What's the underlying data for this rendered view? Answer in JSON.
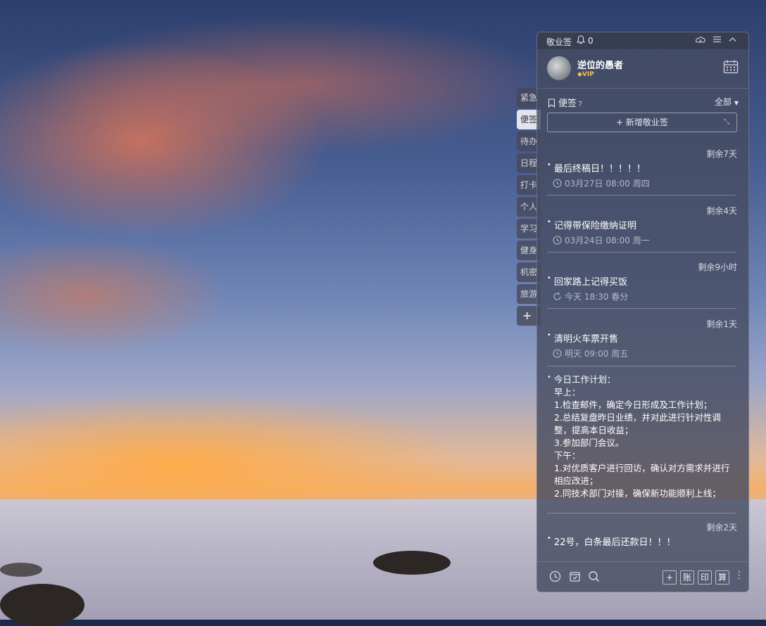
{
  "app": {
    "title": "敬业签",
    "notification_count": "0"
  },
  "profile": {
    "name": "逆位的愚者",
    "badge": "VIP"
  },
  "side_tabs": [
    "紧急",
    "便签",
    "待办",
    "日程",
    "打卡",
    "个人",
    "学习",
    "健身",
    "机密",
    "旅游"
  ],
  "side_add": "+",
  "section": {
    "title": "便签",
    "count": "7",
    "filter": "全部",
    "new_button": "+ 新增敬业签"
  },
  "notes": [
    {
      "remain": "剩余7天",
      "title": "最后终稿日！！！！！",
      "meta": "03月27日 08:00 周四"
    },
    {
      "remain": "剩余4天",
      "title": "记得带保险缴纳证明",
      "meta": "03月24日 08:00 周一"
    },
    {
      "remain": "剩余9小时",
      "title": "回家路上记得买饭",
      "meta": "今天 18:30 春分"
    },
    {
      "remain": "剩余1天",
      "title": "清明火车票开售",
      "meta": "明天 09:00 周五"
    }
  ],
  "long_note": {
    "lines": [
      "今日工作计划：",
      "早上：",
      "1.检查邮件，确定今日形成及工作计划；",
      "2.总结复盘昨日业绩，并对此进行针对性调整，提高本日收益；",
      "3.参加部门会议。",
      "下午：",
      "1.对优质客户进行回访，确认对方需求并进行相应改进；",
      "2.同技术部门对接，确保新功能顺利上线；"
    ]
  },
  "last_note": {
    "remain": "剩余2天",
    "title": "22号，白条最后还款日！！！"
  },
  "footer": {
    "box_buttons": [
      "+",
      "账",
      "印",
      "算"
    ]
  },
  "colors": {
    "panel_bg": "#464c62",
    "vip": "#f6c342",
    "accent_text": "#ffffff"
  }
}
